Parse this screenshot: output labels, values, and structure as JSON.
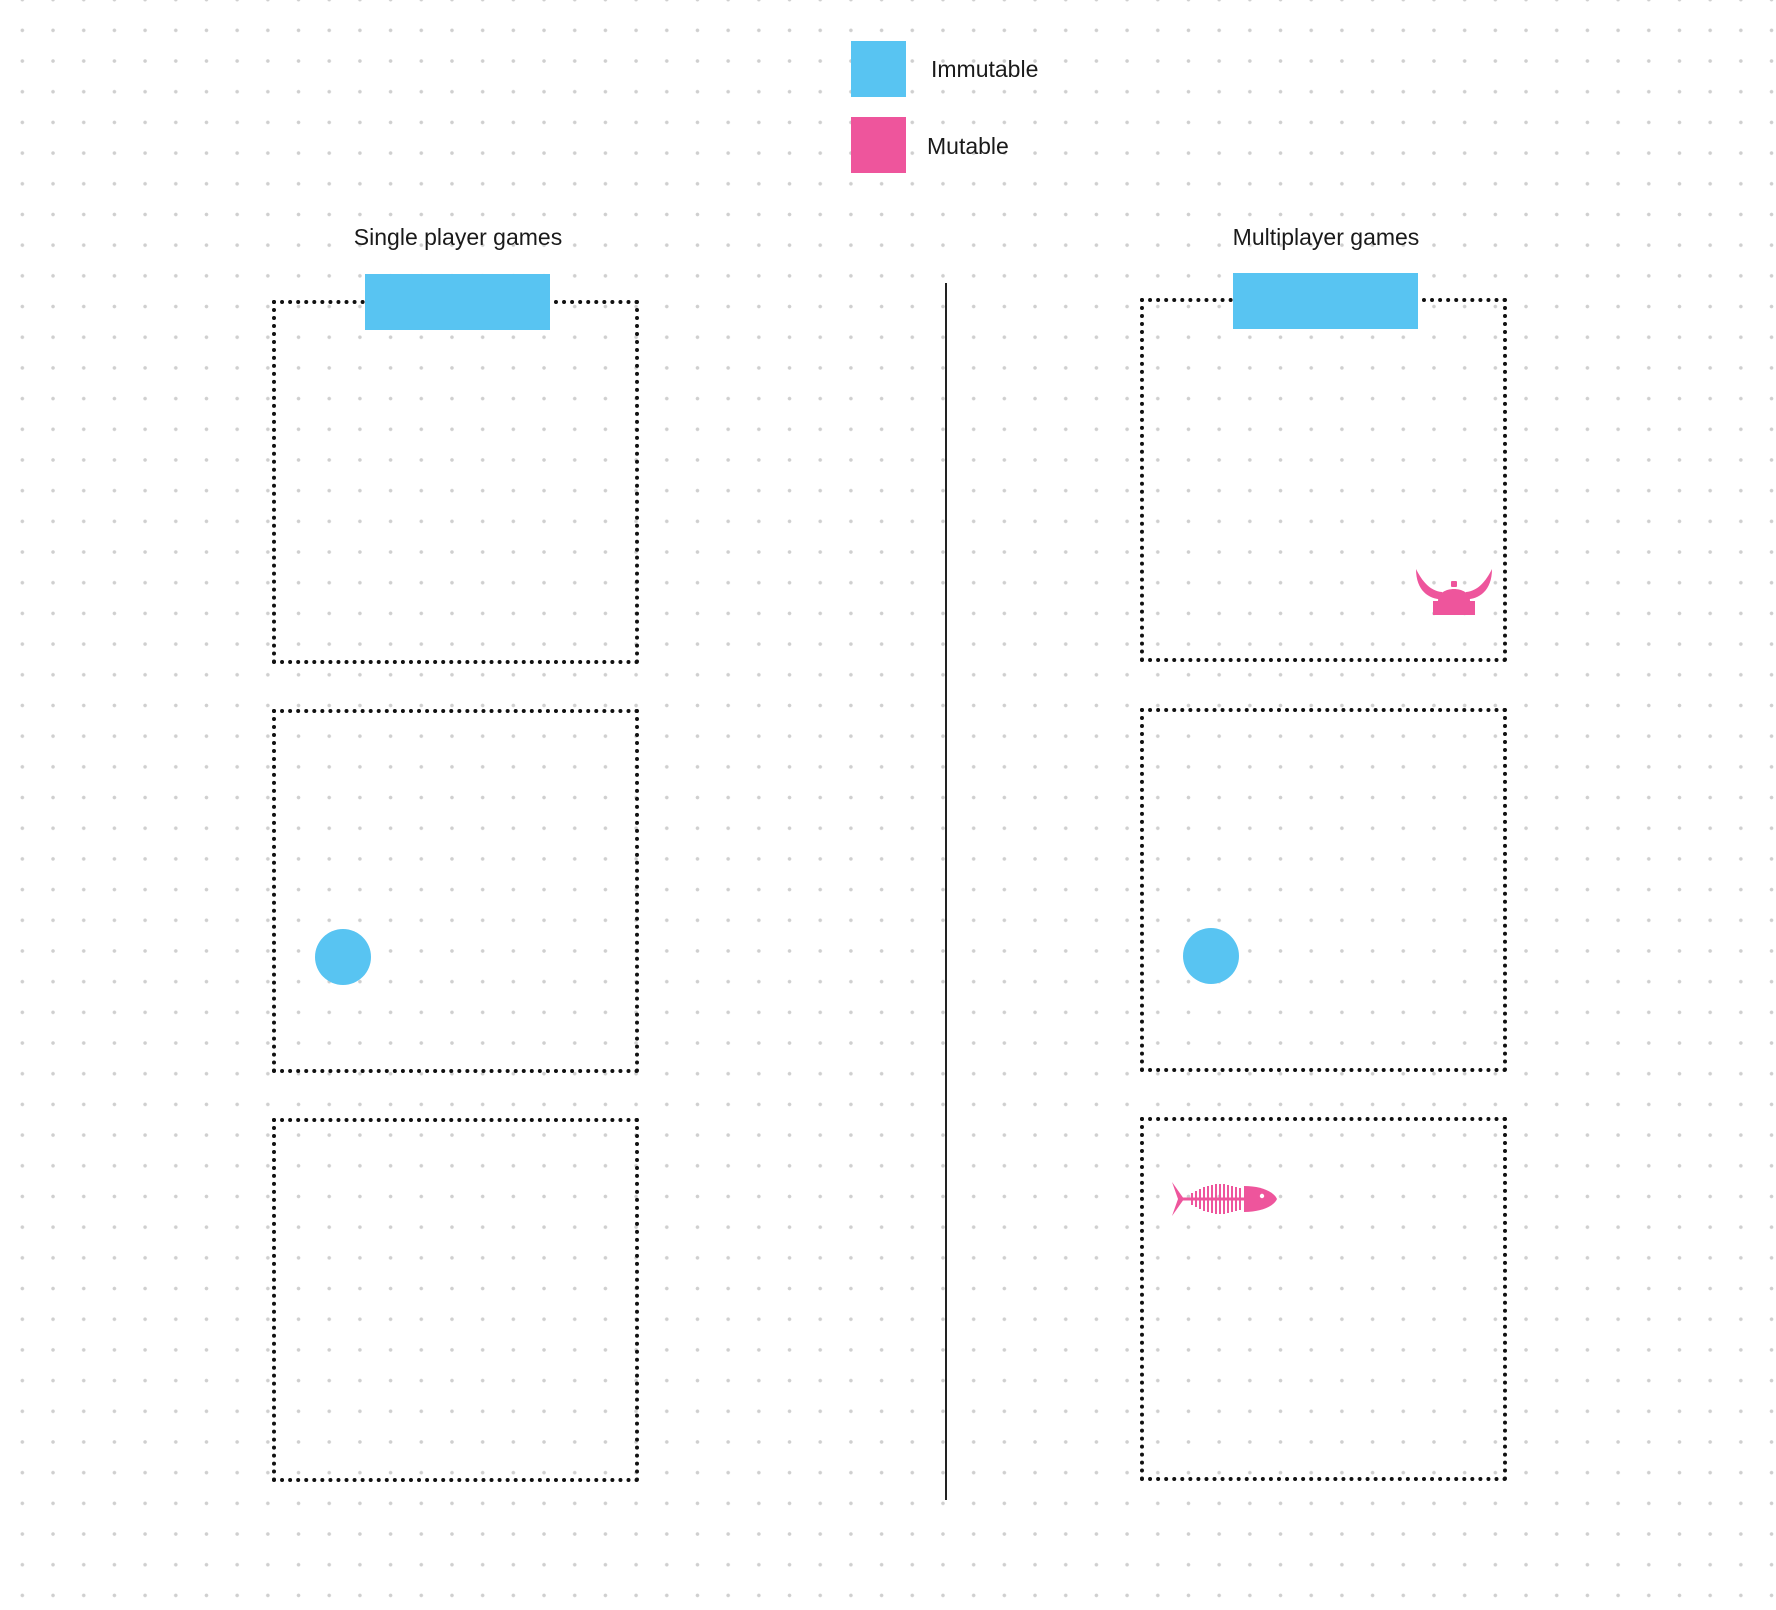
{
  "legend": {
    "items": [
      {
        "label": "Immutable",
        "color": "#58C4F2"
      },
      {
        "label": "Mutable",
        "color": "#EE559C"
      }
    ]
  },
  "columns": [
    {
      "title": "Single player games"
    },
    {
      "title": "Multiplayer games"
    }
  ],
  "colors": {
    "immutable": "#58C4F2",
    "mutable": "#EE559C",
    "frame_border": "#111111",
    "divider": "#222222",
    "grid_dot": "#cfcfcf"
  },
  "icons": {
    "mutable_items": [
      "viking-helmet-icon",
      "fish-bone-icon"
    ],
    "immutable_items": [
      "sticky-note",
      "circle-dot"
    ]
  }
}
